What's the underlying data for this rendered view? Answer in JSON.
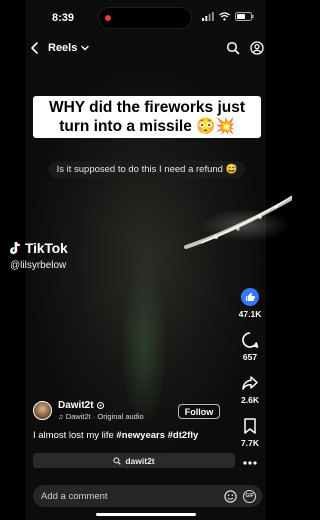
{
  "status": {
    "time": "8:39"
  },
  "nav": {
    "title": "Reels"
  },
  "video": {
    "caption": "WHY did the fireworks just turn into a missile 😳💥",
    "subcaption": "Is it supposed to do this I need a refund 😅",
    "watermark_brand": "TikTok",
    "watermark_user": "@lilsyrbelow"
  },
  "actions": {
    "likes": "47.1K",
    "comments": "657",
    "shares": "2.6K",
    "saves": "7.7K"
  },
  "post": {
    "author": "Dawit2t",
    "audio": "Dawit2t · Original audio",
    "follow_label": "Follow",
    "description_text": "I almost lost my life ",
    "hashtags": "#newyears #dt2fly",
    "search_query": "dawit2t"
  },
  "comment": {
    "placeholder": "Add a comment",
    "gif_label": "GIF"
  },
  "colors": {
    "like_accent": "#3478f6",
    "recording": "#e23b3b",
    "background": "#000000"
  },
  "icons": [
    "back-icon",
    "chevron-down-icon",
    "search-icon",
    "profile-icon",
    "heart-icon",
    "comment-icon",
    "share-icon",
    "bookmark-icon",
    "more-icon",
    "emoji-icon",
    "gif-icon"
  ]
}
